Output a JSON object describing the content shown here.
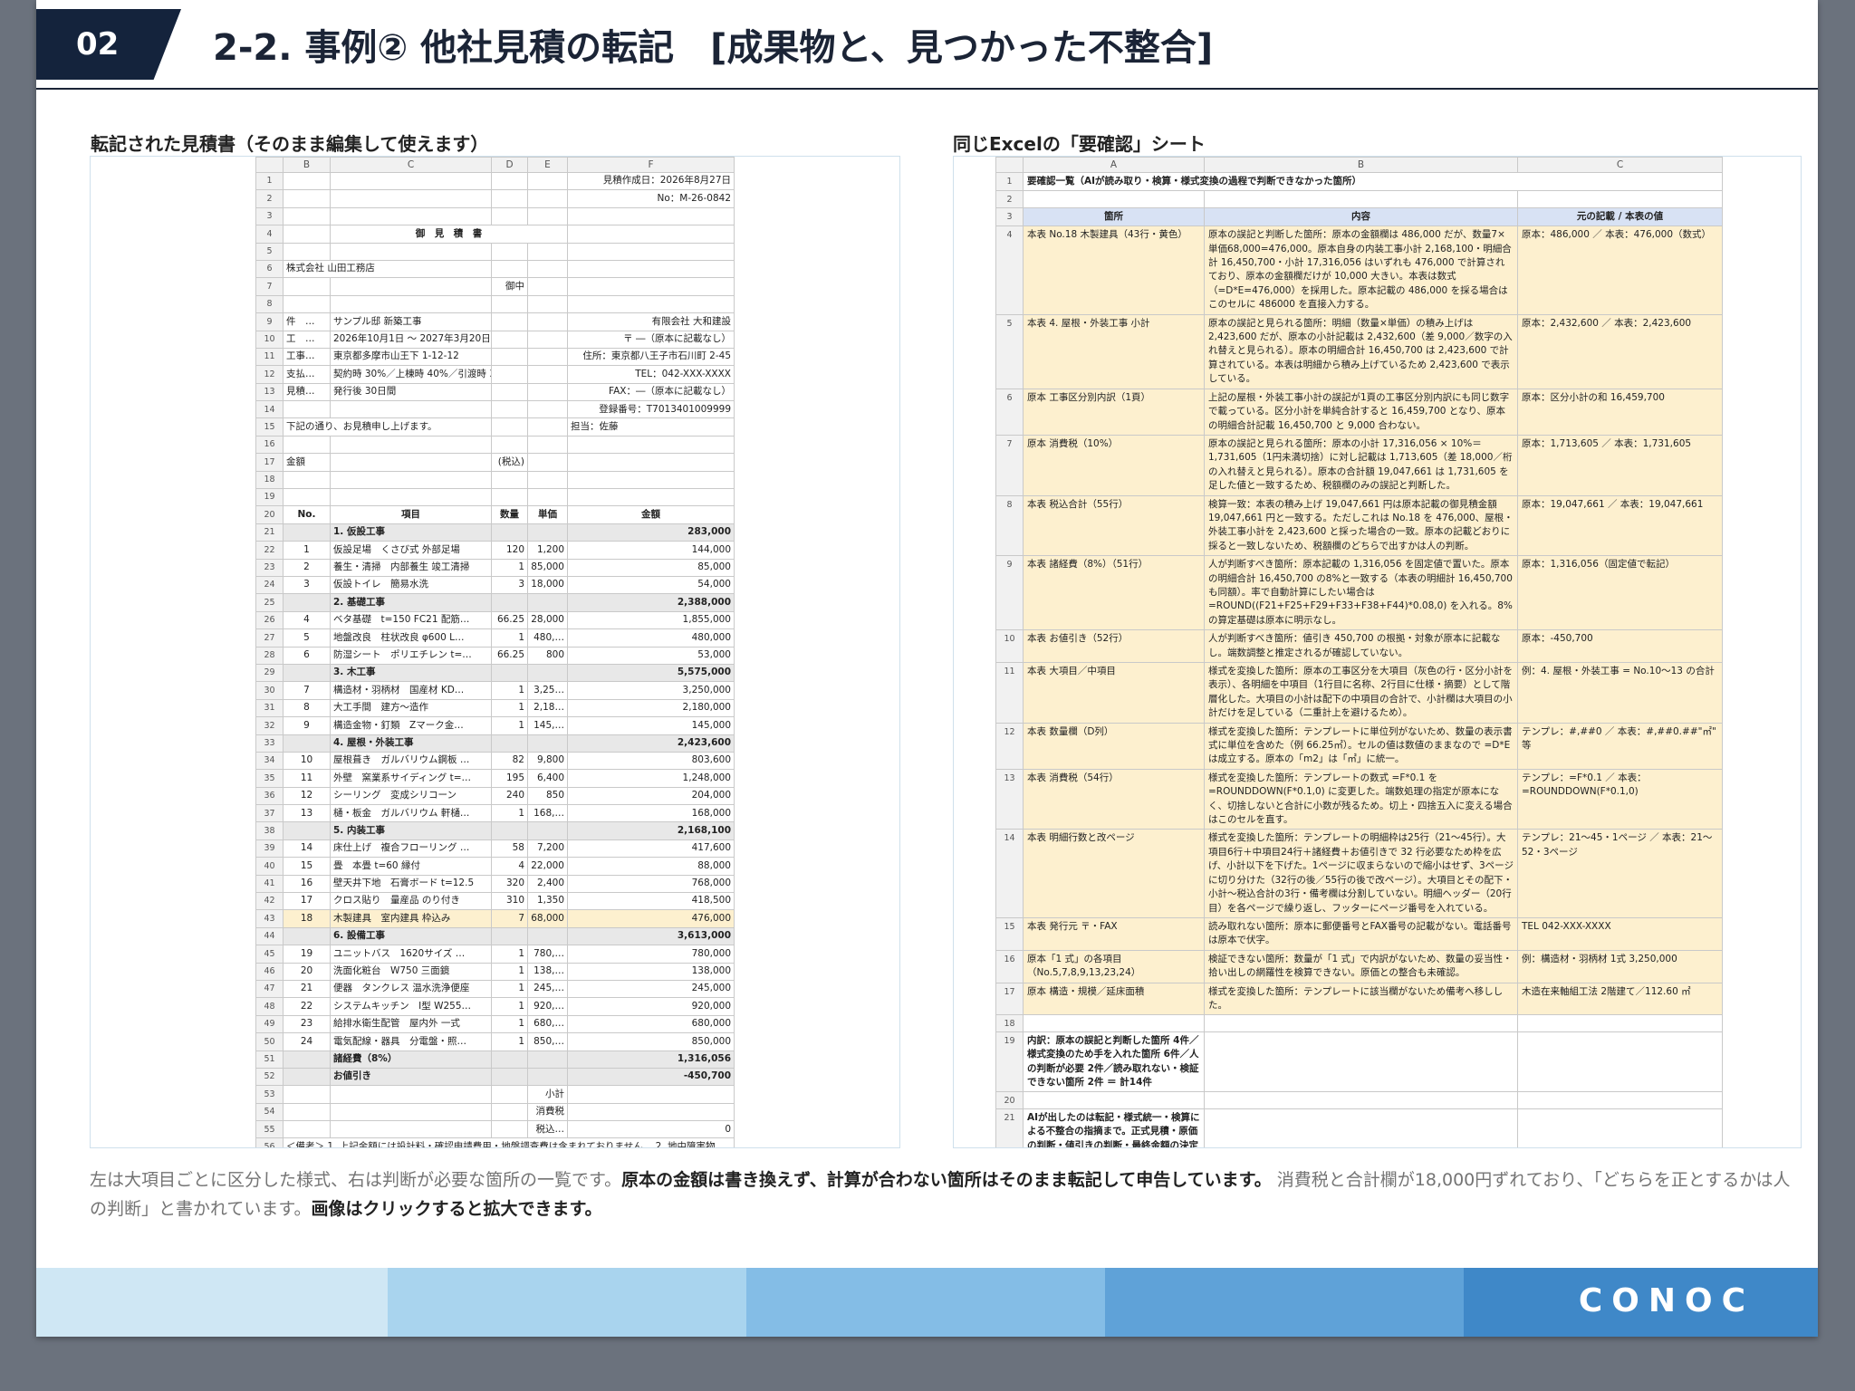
{
  "header": {
    "number": "02",
    "title": "2-2. 事例② 他社見積の転記　[成果物と、見つかった不整合]"
  },
  "left_caption": "転記された見積書（そのまま編集して使えます）",
  "right_caption": "同じExcelの「要確認」シート",
  "estimate": {
    "col_headers": [
      "B",
      "C",
      "D",
      "E",
      "F"
    ],
    "rows": [
      {
        "n": "1",
        "b": "",
        "c": "",
        "d": "",
        "e": "",
        "f": "見積作成日：2026年8月27日"
      },
      {
        "n": "2",
        "b": "",
        "c": "",
        "d": "",
        "e": "",
        "f": "No：M-26-0842"
      },
      {
        "n": "3",
        "b": "",
        "c": "",
        "d": "",
        "e": "",
        "f": ""
      },
      {
        "n": "4",
        "b": "",
        "c": "御　見　積　書",
        "d": "",
        "e": "",
        "f": "",
        "merge": true
      },
      {
        "n": "5",
        "b": "",
        "c": "",
        "d": "",
        "e": "",
        "f": ""
      },
      {
        "n": "6",
        "b": "株式会社 山田工務店",
        "c": "",
        "d": "",
        "e": "",
        "f": "",
        "bspan": true
      },
      {
        "n": "7",
        "b": "",
        "c": "",
        "d": "御中",
        "e": "",
        "f": ""
      },
      {
        "n": "8",
        "b": "",
        "c": "",
        "d": "",
        "e": "",
        "f": ""
      },
      {
        "n": "9",
        "b": "件　…",
        "c": "サンプル邸 新築工事",
        "d": "",
        "e": "",
        "f": "有限会社 大和建設"
      },
      {
        "n": "10",
        "b": "工　…",
        "c": "2026年10月1日 〜 2027年3月20日",
        "d": "",
        "e": "",
        "f": "〒 ―（原本に記載なし）"
      },
      {
        "n": "11",
        "b": "工事…",
        "c": "東京都多摩市山王下 1-12-12",
        "d": "",
        "e": "",
        "f": "住所：東京都八王子市石川町 2-45"
      },
      {
        "n": "12",
        "b": "支払…",
        "c": "契約時 30%／上棟時 40%／引渡時 30%",
        "d": "",
        "e": "",
        "f": "TEL：042-XXX-XXXX"
      },
      {
        "n": "13",
        "b": "見積…",
        "c": "発行後 30日間",
        "d": "",
        "e": "",
        "f": "FAX：―（原本に記載なし）"
      },
      {
        "n": "14",
        "b": "",
        "c": "",
        "d": "",
        "e": "",
        "f": "登録番号：T7013401009999"
      },
      {
        "n": "15",
        "b": "下記の通り、お見積申し上げます。",
        "c": "",
        "d": "",
        "e": "",
        "f": "担当：佐藤",
        "bspan": true
      },
      {
        "n": "16",
        "b": "",
        "c": "",
        "d": "",
        "e": "",
        "f": ""
      },
      {
        "n": "17",
        "b": "金額",
        "c": "",
        "d": "(税込)",
        "e": "",
        "f": ""
      },
      {
        "n": "18",
        "b": "",
        "c": "",
        "d": "",
        "e": "",
        "f": ""
      },
      {
        "n": "19",
        "b": "",
        "c": "",
        "d": "",
        "e": "",
        "f": ""
      },
      {
        "n": "20",
        "b": "No.",
        "c": "項目",
        "d": "数量",
        "e": "単価",
        "f": "金額",
        "type": "hdr"
      },
      {
        "n": "21",
        "b": "",
        "c": "1. 仮設工事",
        "d": "",
        "e": "",
        "f": "283,000",
        "type": "sec"
      },
      {
        "n": "22",
        "b": "1",
        "c": "仮設足場　くさび式 外部足場",
        "d": "120",
        "e": "1,200",
        "f": "144,000"
      },
      {
        "n": "23",
        "b": "2",
        "c": "養生・清掃　内部養生 竣工清掃",
        "d": "1",
        "e": "85,000",
        "f": "85,000"
      },
      {
        "n": "24",
        "b": "3",
        "c": "仮設トイレ　簡易水洗",
        "d": "3",
        "e": "18,000",
        "f": "54,000"
      },
      {
        "n": "25",
        "b": "",
        "c": "2. 基礎工事",
        "d": "",
        "e": "",
        "f": "2,388,000",
        "type": "sec"
      },
      {
        "n": "26",
        "b": "4",
        "c": "ベタ基礎　t=150 FC21 配筋…",
        "d": "66.25",
        "e": "28,000",
        "f": "1,855,000"
      },
      {
        "n": "27",
        "b": "5",
        "c": "地盤改良　柱状改良 φ600 L…",
        "d": "1",
        "e": "480,…",
        "f": "480,000"
      },
      {
        "n": "28",
        "b": "6",
        "c": "防湿シート　ポリエチレン t=…",
        "d": "66.25",
        "e": "800",
        "f": "53,000"
      },
      {
        "n": "29",
        "b": "",
        "c": "3. 木工事",
        "d": "",
        "e": "",
        "f": "5,575,000",
        "type": "sec"
      },
      {
        "n": "30",
        "b": "7",
        "c": "構造材・羽柄材　国産材 KD…",
        "d": "1",
        "e": "3,25…",
        "f": "3,250,000"
      },
      {
        "n": "31",
        "b": "8",
        "c": "大工手間　建方〜造作",
        "d": "1",
        "e": "2,18…",
        "f": "2,180,000"
      },
      {
        "n": "32",
        "b": "9",
        "c": "構造金物・釘類　Zマーク金…",
        "d": "1",
        "e": "145,…",
        "f": "145,000"
      },
      {
        "n": "33",
        "b": "",
        "c": "4. 屋根・外装工事",
        "d": "",
        "e": "",
        "f": "2,423,600",
        "type": "sec"
      },
      {
        "n": "34",
        "b": "10",
        "c": "屋根葺き　ガルバリウム鋼板 …",
        "d": "82",
        "e": "9,800",
        "f": "803,600"
      },
      {
        "n": "35",
        "b": "11",
        "c": "外壁　窯業系サイディング t=…",
        "d": "195",
        "e": "6,400",
        "f": "1,248,000"
      },
      {
        "n": "36",
        "b": "12",
        "c": "シーリング　変成シリコーン",
        "d": "240",
        "e": "850",
        "f": "204,000"
      },
      {
        "n": "37",
        "b": "13",
        "c": "樋・板金　ガルバリウム 軒樋…",
        "d": "1",
        "e": "168,…",
        "f": "168,000"
      },
      {
        "n": "38",
        "b": "",
        "c": "5. 内装工事",
        "d": "",
        "e": "",
        "f": "2,168,100",
        "type": "sec"
      },
      {
        "n": "39",
        "b": "14",
        "c": "床仕上げ　複合フローリング …",
        "d": "58",
        "e": "7,200",
        "f": "417,600"
      },
      {
        "n": "40",
        "b": "15",
        "c": "畳　本畳 t=60 縁付",
        "d": "4",
        "e": "22,000",
        "f": "88,000"
      },
      {
        "n": "41",
        "b": "16",
        "c": "壁天井下地　石膏ボード t=12.5",
        "d": "320",
        "e": "2,400",
        "f": "768,000"
      },
      {
        "n": "42",
        "b": "17",
        "c": "クロス貼り　量産品 のり付き",
        "d": "310",
        "e": "1,350",
        "f": "418,500"
      },
      {
        "n": "43",
        "b": "18",
        "c": "木製建具　室内建具 枠込み",
        "d": "7",
        "e": "68,000",
        "f": "476,000",
        "type": "hl"
      },
      {
        "n": "44",
        "b": "",
        "c": "6. 設備工事",
        "d": "",
        "e": "",
        "f": "3,613,000",
        "type": "sec"
      },
      {
        "n": "45",
        "b": "19",
        "c": "ユニットバス　1620サイズ …",
        "d": "1",
        "e": "780,…",
        "f": "780,000"
      },
      {
        "n": "46",
        "b": "20",
        "c": "洗面化粧台　W750 三面鏡",
        "d": "1",
        "e": "138,…",
        "f": "138,000"
      },
      {
        "n": "47",
        "b": "21",
        "c": "便器　タンクレス 温水洗浄便座",
        "d": "1",
        "e": "245,…",
        "f": "245,000"
      },
      {
        "n": "48",
        "b": "22",
        "c": "システムキッチン　I型 W255…",
        "d": "1",
        "e": "920,…",
        "f": "920,000"
      },
      {
        "n": "49",
        "b": "23",
        "c": "給排水衛生配管　屋内外 一式",
        "d": "1",
        "e": "680,…",
        "f": "680,000"
      },
      {
        "n": "50",
        "b": "24",
        "c": "電気配線・器具　分電盤・照…",
        "d": "1",
        "e": "850,…",
        "f": "850,000"
      },
      {
        "n": "51",
        "b": "",
        "c": "諸経費（8%）",
        "d": "",
        "e": "",
        "f": "1,316,056",
        "type": "sec"
      },
      {
        "n": "52",
        "b": "",
        "c": "お値引き",
        "d": "",
        "e": "",
        "f": "-450,700",
        "type": "sec"
      },
      {
        "n": "53",
        "b": "",
        "c": "",
        "d": "",
        "e": "小計",
        "f": ""
      },
      {
        "n": "54",
        "b": "",
        "c": "",
        "d": "",
        "e": "消費税",
        "f": ""
      },
      {
        "n": "55",
        "b": "",
        "c": "",
        "d": "",
        "e": "税込…",
        "f": "0"
      },
      {
        "n": "56",
        "b": "＜備考＞ 1. 上記金額には設計料・確認申請費用・地盤調査費は含まれておりません。 2. 地中障害物…",
        "c": "",
        "d": "",
        "e": "",
        "f": "",
        "full": true
      }
    ]
  },
  "review": {
    "col_headers": [
      "A",
      "B",
      "C"
    ],
    "title": "要確認一覧（AIが読み取り・検算・様式変換の過程で判断できなかった箇所）",
    "headers": [
      "箇所",
      "内容",
      "元の記載 / 本表の値"
    ],
    "rows": [
      {
        "n": "4",
        "a": "本表 No.18 木製建具（43行・黄色）",
        "b": "原本の誤記と判断した箇所：原本の金額欄は 486,000 だが、数量7×単価68,000=476,000。原本自身の内装工事小計 2,168,100・明細合計 16,450,700・小計 17,316,056 はいずれも 476,000 で計算されており、原本の金額欄だけが 10,000 大きい。本表は数式（=D*E=476,000）を採用した。原本記載の 486,000 を採る場合はこのセルに 486000 を直接入力する。",
        "c": "原本：486,000 ／ 本表：476,000（数式）"
      },
      {
        "n": "5",
        "a": "本表 4. 屋根・外装工事 小計",
        "b": "原本の誤記と見られる箇所：明細（数量×単価）の積み上げは 2,423,600 だが、原本の小計記載は 2,432,600（差 9,000／数字の入れ替えと見られる）。原本の明細合計 16,450,700 は 2,423,600 で計算されている。本表は明細から積み上げているため 2,423,600 で表示している。",
        "c": "原本：2,432,600 ／ 本表：2,423,600"
      },
      {
        "n": "6",
        "a": "原本 工事区分別内訳（1頁）",
        "b": "上記の屋根・外装工事小計の誤記が1頁の工事区分別内訳にも同じ数字で載っている。区分小計を単純合計すると 16,459,700 となり、原本の明細合計記載 16,450,700 と 9,000 合わない。",
        "c": "原本：区分小計の和 16,459,700"
      },
      {
        "n": "7",
        "a": "原本 消費税（10%）",
        "b": "原本の誤記と見られる箇所：原本の小計 17,316,056 × 10%＝1,731,605（1円未満切捨）に対し記載は 1,713,605（差 18,000／桁の入れ替えと見られる）。原本の合計額 19,047,661 は 1,731,605 を足した値と一致するため、税額欄のみの誤記と判断した。",
        "c": "原本：1,713,605 ／ 本表：1,731,605"
      },
      {
        "n": "8",
        "a": "本表 税込合計（55行）",
        "b": "検算一致：本表の積み上げ 19,047,661 円は原本記載の御見積金額 19,047,661 円と一致する。ただしこれは No.18 を 476,000、屋根・外装工事小計を 2,423,600 と採った場合の一致。原本の記載どおりに採ると一致しないため、税額欄のどちらで出すかは人の判断。",
        "c": "原本：19,047,661 ／ 本表：19,047,661"
      },
      {
        "n": "9",
        "a": "本表 諸経費（8%）（51行）",
        "b": "人が判断すべき箇所：原本記載の 1,316,056 を固定値で置いた。原本の明細合計 16,450,700 の8%と一致する（本表の明細計 16,450,700 も同額）。率で自動計算にしたい場合は =ROUND((F21+F25+F29+F33+F38+F44)*0.08,0) を入れる。8%の算定基礎は原本に明示なし。",
        "c": "原本：1,316,056（固定値で転記）"
      },
      {
        "n": "10",
        "a": "本表 お値引き（52行）",
        "b": "人が判断すべき箇所：値引き 450,700 の根拠・対象が原本に記載なし。端数調整と推定されるが確認していない。",
        "c": "原本：-450,700"
      },
      {
        "n": "11",
        "a": "本表 大項目／中項目",
        "b": "様式を変換した箇所：原本の工事区分を大項目（灰色の行・区分小計を表示）、各明細を中項目（1行目に名称、2行目に仕様・摘要）として階層化した。大項目の小計は配下の中項目の合計で、小計欄は大項目の小計だけを足している（二重計上を避けるため）。",
        "c": "例：4. 屋根・外装工事 = No.10〜13 の合計"
      },
      {
        "n": "12",
        "a": "本表 数量欄（D列）",
        "b": "様式を変換した箇所：テンプレートに単位列がないため、数量の表示書式に単位を含めた（例 66.25㎡）。セルの値は数値のままなので =D*E は成立する。原本の「m2」は「㎡」に統一。",
        "c": "テンプレ：#,##0 ／ 本表：#,##0.##\"㎡\" 等"
      },
      {
        "n": "13",
        "a": "本表 消費税（54行）",
        "b": "様式を変換した箇所：テンプレートの数式 =F*0.1 を =ROUNDDOWN(F*0.1,0) に変更した。端数処理の指定が原本になく、切捨しないと合計に小数が残るため。切上・四捨五入に変える場合はこのセルを直す。",
        "c": "テンプレ：=F*0.1 ／ 本表：=ROUNDDOWN(F*0.1,0)"
      },
      {
        "n": "14",
        "a": "本表 明細行数と改ページ",
        "b": "様式を変換した箇所：テンプレートの明細枠は25行（21〜45行）。大項目6行＋中項目24行＋諸経費＋お値引きで 32 行必要なため枠を広げ、小計以下を下げた。1ページに収まらないので縮小はせず、3ページに切り分けた（32行の後／55行の後で改ページ）。大項目とその配下・小計〜税込合計の3行・備考欄は分割していない。明細ヘッダー（20行目）を各ページで繰り返し、フッターにページ番号を入れている。",
        "c": "テンプレ：21〜45・1ページ ／ 本表：21〜52・3ページ"
      },
      {
        "n": "15",
        "a": "本表 発行元 〒・FAX",
        "b": "読み取れない箇所：原本に郵便番号とFAX番号の記載がない。電話番号は原本で伏字。",
        "c": "TEL 042-XXX-XXXX"
      },
      {
        "n": "16",
        "a": "原本「1 式」の各項目（No.5,7,8,9,13,23,24）",
        "b": "検証できない箇所：数量が「1 式」で内訳がないため、数量の妥当性・拾い出しの網羅性を検算できない。原価との整合も未確認。",
        "c": "例：構造材・羽柄材 1式 3,250,000"
      },
      {
        "n": "17",
        "a": "原本 構造・規模／延床面積",
        "b": "様式を変換した箇所：テンプレートに該当欄がないため備考へ移しした。",
        "c": "木造在来軸組工法 2階建て／112.60 ㎡"
      },
      {
        "n": "18",
        "a": "",
        "b": "",
        "c": ""
      },
      {
        "n": "19",
        "a": "内訳：原本の誤記と判断した箇所 4件／様式変換のため手を入れた箇所 6件／人の判断が必要 2件／読み取れない・検証できない箇所 2件 ＝ 計14件",
        "b": "",
        "c": "",
        "bold": true
      },
      {
        "n": "20",
        "a": "",
        "b": "",
        "c": ""
      },
      {
        "n": "21",
        "a": "AIが出したのは転記・様式統一・検算による不整合の指摘まで。正式見積・原価の判断・値引きの判断・最終金額の決定は人が持つ。",
        "b": "",
        "c": "",
        "bold": true
      }
    ]
  },
  "description": {
    "p1": "左は大項目ごとに区分した様式、右は判断が必要な箇所の一覧です。",
    "p2": "原本の金額は書き換えず、計算が合わない箇所はそのまま転記して申告しています。",
    "p3": " 消費税と合計欄が18,000円ずれており、「どちらを正とするかは人の判断」と書かれています。",
    "p4": "画像はクリックすると拡大できます。"
  },
  "footer": {
    "logo": "CONOC",
    "colors": [
      "#cfe7f4",
      "#a9d4ee",
      "#84bde6",
      "#5fa2d8",
      "#3f88c8"
    ]
  }
}
